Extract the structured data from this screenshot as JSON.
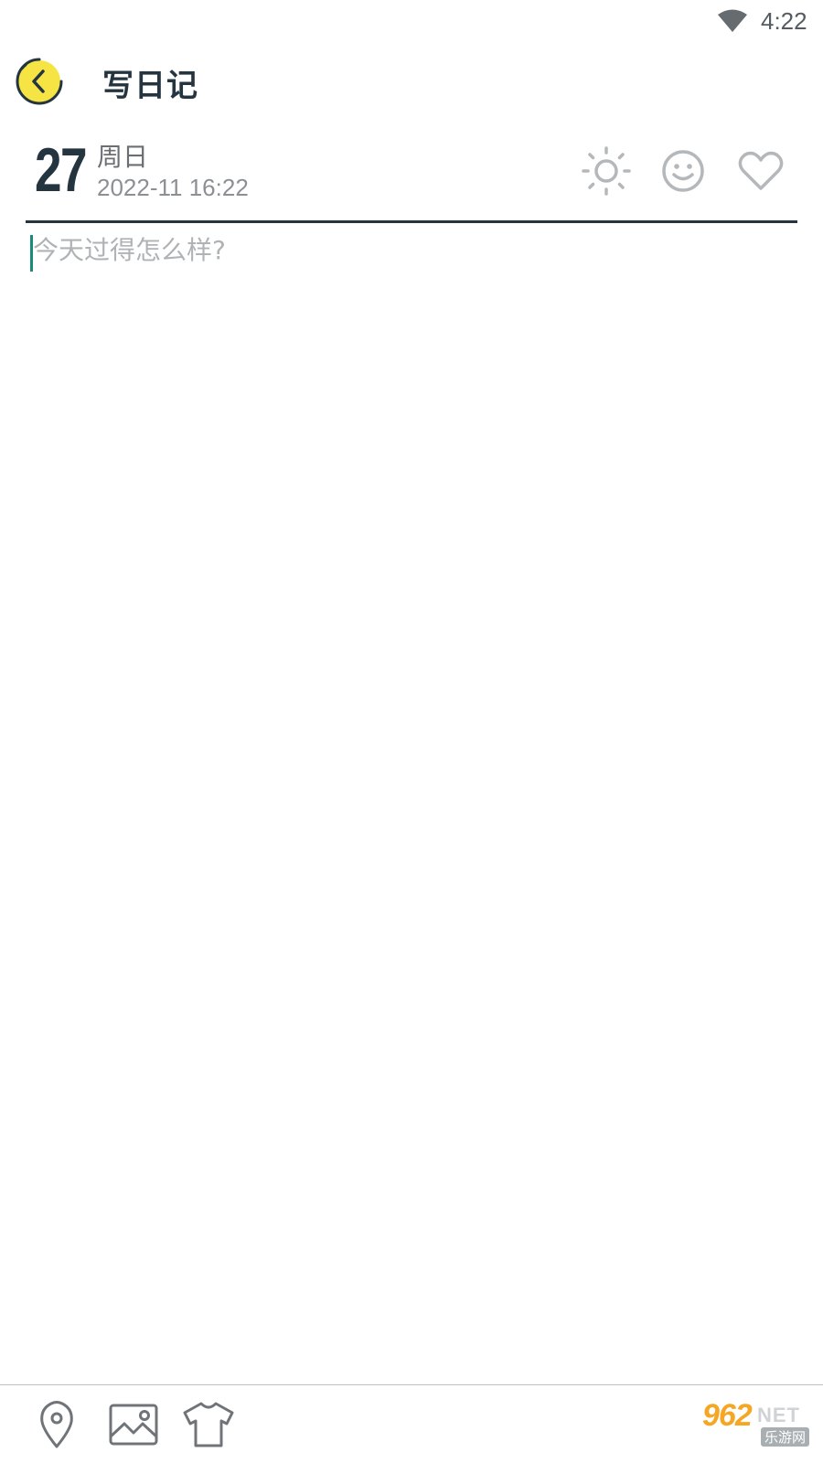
{
  "status_bar": {
    "time": "4:22",
    "wifi_icon": "wifi-icon"
  },
  "header": {
    "back_icon": "back-arrow-icon",
    "title": "写日记"
  },
  "date": {
    "day": "27",
    "weekday": "周日",
    "datetime": "2022-11 16:22"
  },
  "actions": [
    {
      "name": "weather",
      "icon": "sun-icon"
    },
    {
      "name": "mood",
      "icon": "smiley-icon"
    },
    {
      "name": "favorite",
      "icon": "heart-icon"
    }
  ],
  "editor": {
    "placeholder": "今天过得怎么样?",
    "value": ""
  },
  "toolbar": [
    {
      "name": "location",
      "icon": "location-pin-icon"
    },
    {
      "name": "image",
      "icon": "image-icon"
    },
    {
      "name": "clothes",
      "icon": "tshirt-icon"
    }
  ],
  "watermark": {
    "brand": "962",
    "suffix": "NET",
    "sub": "乐游网"
  },
  "colors": {
    "primary": "#253540",
    "accent_yellow": "#f6e445",
    "icon_gray": "#b5b8bb",
    "caret": "#1a8a7a"
  }
}
